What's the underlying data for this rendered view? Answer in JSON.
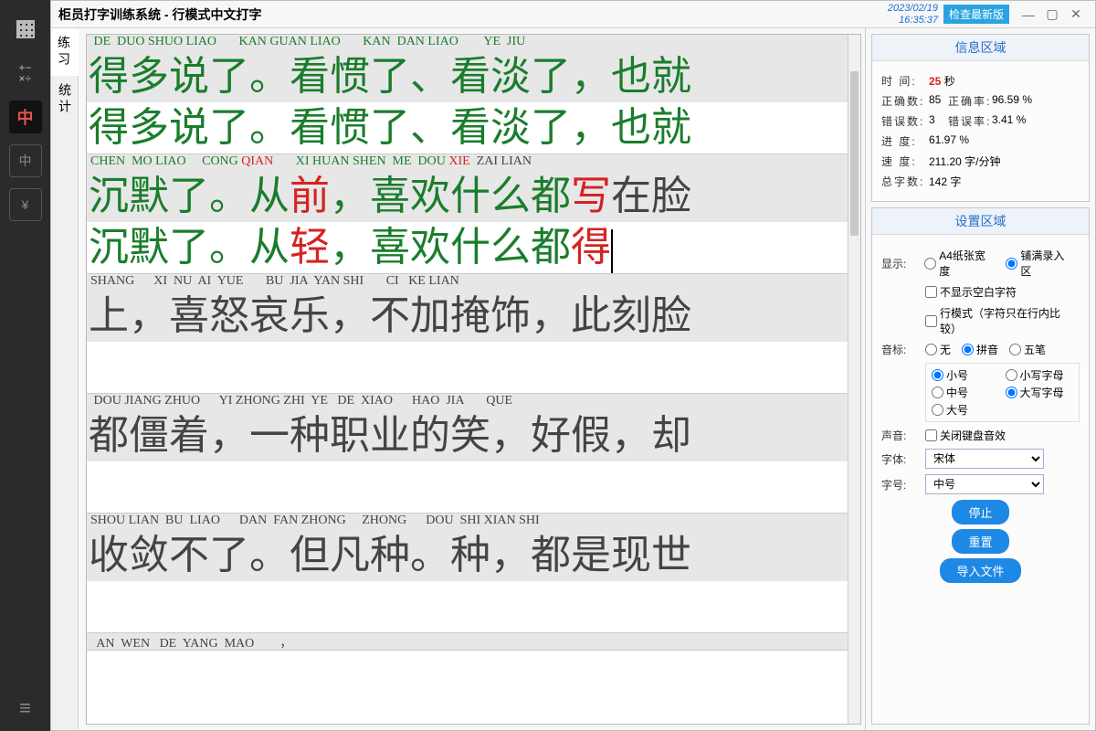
{
  "window": {
    "title": "柜员打字训练系统 - 行模式中文打字",
    "date": "2023/02/19",
    "time": "16:35:37",
    "check_update": "检查最新版"
  },
  "rail_icons": [
    "grid",
    "calc",
    "中",
    "中",
    "¥",
    "apps",
    "menu"
  ],
  "vtabs": {
    "practice": "练习",
    "stats": "统计"
  },
  "rows": [
    {
      "pinyin_html": "<span class='tg'> DE  DUO SHUO LIAO       KAN GUAN LIAO       KAN  DAN LIAO        YE  JIU</span>",
      "target_html": "<span class='g'>得多说了。看惯了、看淡了，也就</span>",
      "input_html": "<span class='g'>得多说了。看惯了、看淡了，也就</span>",
      "has_input": true
    },
    {
      "pinyin_html": "<span class='tg'>CHEN  MO LIAO     CONG </span><span class='tr'>QIAN</span><span class='tg'>       XI HUAN SHEN  ME  DOU </span><span class='tr'>XIE</span><span class='tk'>  ZAI LIAN</span>",
      "target_html": "<span class='g'>沉默了。从</span><span class='r'>前</span><span class='g'>，喜欢什么都</span><span class='r'>写</span><span class='k'>在脸</span>",
      "input_html": "<span class='g'>沉默了。从</span><span class='r'>轻</span><span class='g'>，喜欢什么都</span><span class='r'>得</span><span class='cursor'></span>",
      "has_input": true
    },
    {
      "pinyin_html": "<span class='tk'>SHANG      XI  NU  AI  YUE       BU  JIA  YAN SHI       CI   KE LIAN</span>",
      "target_html": "<span class='k'>上，喜怒哀乐，不加掩饰，此刻脸</span>",
      "input_html": "",
      "has_input": true
    },
    {
      "pinyin_html": "<span class='tk'> DOU JIANG ZHUO      YI ZHONG ZHI  YE   DE  XIAO      HAO  JIA       QUE</span>",
      "target_html": "<span class='k'>都僵着，一种职业的笑，好假，却</span>",
      "input_html": "",
      "has_input": true
    },
    {
      "pinyin_html": "<span class='tk'>SHOU LIAN  BU  LIAO      DAN  FAN ZHONG     ZHONG      DOU  SHI XIAN SHI</span>",
      "target_html": "<span class='k'>收敛不了。但凡种。种，都是现世</span>",
      "input_html": "",
      "has_input": true
    },
    {
      "pinyin_html": "<span class='tk'>  AN  WEN   DE  YANG  MAO        ，</span>",
      "target_html": "",
      "input_html": "",
      "has_input": false
    }
  ],
  "info": {
    "title": "信息区域",
    "time_label": "时 间:",
    "time_value": "25",
    "time_unit": "秒",
    "correct_count_label": "正确数:",
    "correct_count": "85",
    "correct_rate_label": "正确率:",
    "correct_rate": "96.59 %",
    "error_count_label": "错误数:",
    "error_count": "3",
    "error_rate_label": "错误率:",
    "error_rate": "3.41 %",
    "progress_label": "进 度:",
    "progress": "61.97 %",
    "speed_label": "速 度:",
    "speed": "211.20 字/分钟",
    "total_label": "总字数:",
    "total": "142 字"
  },
  "settings": {
    "title": "设置区域",
    "display_label": "显示:",
    "display_a4": "A4纸张宽度",
    "display_fill": "铺满录入区",
    "hide_blank": "不显示空白字符",
    "line_mode": "行模式（字符只在行内比较）",
    "phonetic_label": "音标:",
    "ph_none": "无",
    "ph_pinyin": "拼音",
    "ph_wubi": "五笔",
    "size_small": "小号",
    "size_medium": "中号",
    "size_large": "大号",
    "case_lower": "小写字母",
    "case_upper": "大写字母",
    "sound_label": "声音:",
    "sound_off": "关闭键盘音效",
    "font_label": "字体:",
    "font_value": "宋体",
    "fsize_label": "字号:",
    "fsize_value": "中号",
    "btn_stop": "停止",
    "btn_reset": "重置",
    "btn_import": "导入文件"
  }
}
